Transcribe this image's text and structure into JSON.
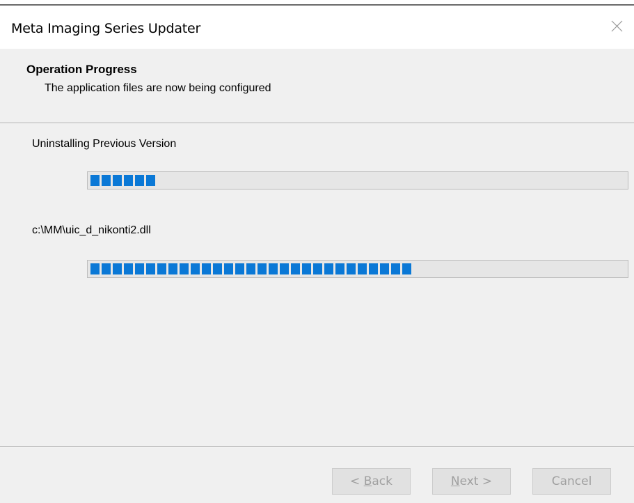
{
  "window": {
    "title": "Meta Imaging Series Updater"
  },
  "header": {
    "title": "Operation Progress",
    "subtitle": "The application files are now being configured"
  },
  "progress": {
    "step_label": "Uninstalling Previous Version",
    "step_percent": 12,
    "file_label": "c:\\MM\\uic_d_nikonti2.dll",
    "file_percent": 61
  },
  "buttons": {
    "back_prefix": "< ",
    "back_mnemonic": "B",
    "back_rest": "ack",
    "next_mnemonic": "N",
    "next_rest": "ext >",
    "cancel": "Cancel"
  },
  "colors": {
    "progress_fill": "#0a78d6",
    "window_bg": "#f0f0f0",
    "titlebar_bg": "#ffffff",
    "disabled_text": "#a0a0a0"
  },
  "icons": {
    "close": "close-icon"
  }
}
